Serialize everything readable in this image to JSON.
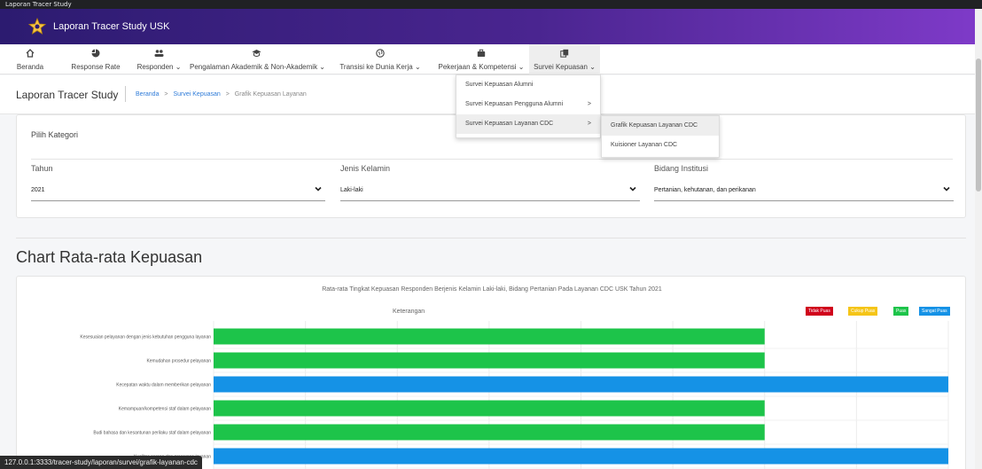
{
  "browser": {
    "tab_title": "Laporan Tracer Study"
  },
  "app": {
    "title": "Laporan Tracer Study USK"
  },
  "nav": [
    {
      "label": "Beranda",
      "icon": "home-icon"
    },
    {
      "label": "Response Rate",
      "icon": "pie-chart-icon"
    },
    {
      "label": "Responden",
      "icon": "users-icon"
    },
    {
      "label": "Pengalaman Akademik & Non-Akademik",
      "icon": "graduation-cap-icon"
    },
    {
      "label": "Transisi ke Dunia Kerja",
      "icon": "globe-icon"
    },
    {
      "label": "Pekerjaan & Kompetensi",
      "icon": "briefcase-icon"
    },
    {
      "label": "Survei Kepuasan",
      "icon": "copy-icon"
    }
  ],
  "breadcrumb": {
    "page_title": "Laporan Tracer Study",
    "home": "Beranda",
    "sep1": ">",
    "section": "Survei Kepuasan",
    "sep2": ">",
    "current": "Grafik Kepuasan Layanan"
  },
  "dropdown": {
    "items": [
      {
        "label": "Survei Kepuasan Alumni",
        "arrow": ""
      },
      {
        "label": "Survei Kepuasan Pengguna Alumni",
        "arrow": ">"
      },
      {
        "label": "Survei Kepuasan Layanan CDC",
        "arrow": ">"
      }
    ],
    "submenu": [
      {
        "label": "Grafik Kepuasan Layanan CDC"
      },
      {
        "label": "Kuisioner Layanan CDC"
      }
    ]
  },
  "filter": {
    "title": "Pilih Kategori",
    "tahun_label": "Tahun",
    "tahun_value": "2021",
    "jenis_kelamin_label": "Jenis Kelamin",
    "jenis_kelamin_value": "Laki-laki",
    "bidang_label": "Bidang Institusi",
    "bidang_value": "Pertanian, kehutanan, dan perikanan"
  },
  "chart_heading": "Chart Rata-rata Kepuasan",
  "legend_label": "Keterangan",
  "colors": {
    "tidak_puas": "#d0021b",
    "cukup_puas": "#f5c518",
    "puas": "#1dc44a",
    "sangat_puas": "#1592e6"
  },
  "chart_data": {
    "type": "bar",
    "orientation": "horizontal",
    "title": "Rata-rata Tingkat Kepuasan Responden Berjenis Kelamin Laki-laki, Bidang Pertanian Pada Layanan CDC USK Tahun 2021",
    "legend": [
      "Tidak Puas",
      "Cukup Puas",
      "Puas",
      "Sangat Puas"
    ],
    "legend_position": "top-right",
    "categories": [
      "Kesesuaian pelayanan dengan jenis kebutuhan pengguna layanan",
      "Kemudahan prosedur pelayanan",
      "Kecepatan waktu dalam memberikan pelayanan",
      "Kemampuan/kompetensi staf dalam pelayanan",
      "Budi bahasa dan kesantunan perilaku staf dalam pelayanan",
      "Kualitas sarana dan prasarana layanan"
    ],
    "values": [
      3,
      3,
      4,
      3,
      3,
      4
    ],
    "bar_classes": [
      "Puas",
      "Puas",
      "Sangat Puas",
      "Puas",
      "Puas",
      "Sangat Puas"
    ],
    "xlim": [
      0,
      4
    ],
    "grid": true
  },
  "status_url": "127.0.0.1:3333/tracer-study/laporan/survei/grafik-layanan-cdc"
}
